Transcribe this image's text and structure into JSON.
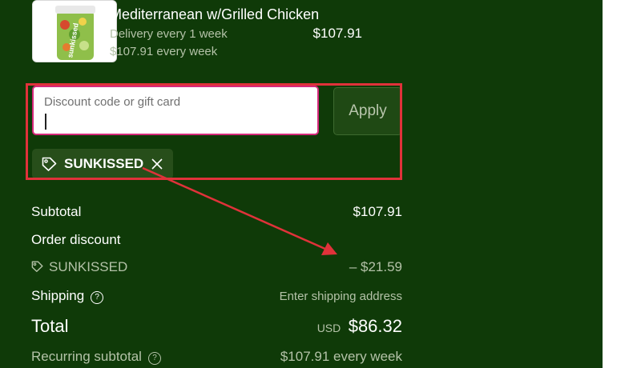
{
  "product": {
    "badge": "g",
    "thumb_label": "sunkissed",
    "name": "Mediterranean w/Grilled Chicken",
    "frequency": "Delivery every 1 week",
    "recurring": "$107.91 every week",
    "price": "$107.91"
  },
  "discount": {
    "placeholder": "Discount code or gift card",
    "apply_label": "Apply",
    "applied_code": "SUNKISSED"
  },
  "summary": {
    "subtotal_label": "Subtotal",
    "subtotal_value": "$107.91",
    "order_discount_label": "Order discount",
    "discount_code": "SUNKISSED",
    "discount_value": "– $21.59",
    "shipping_label": "Shipping",
    "shipping_value": "Enter shipping address",
    "total_label": "Total",
    "currency": "USD",
    "total_value": "$86.32",
    "recurring_label": "Recurring subtotal",
    "recurring_value": "$107.91 every week"
  },
  "colors": {
    "panel_bg": "#0f3a08",
    "annotation_red": "#e0323a",
    "input_focus": "#d6287b"
  },
  "icons": {
    "tag": "tag-icon",
    "remove": "close-icon",
    "help": "question-circle-icon"
  }
}
